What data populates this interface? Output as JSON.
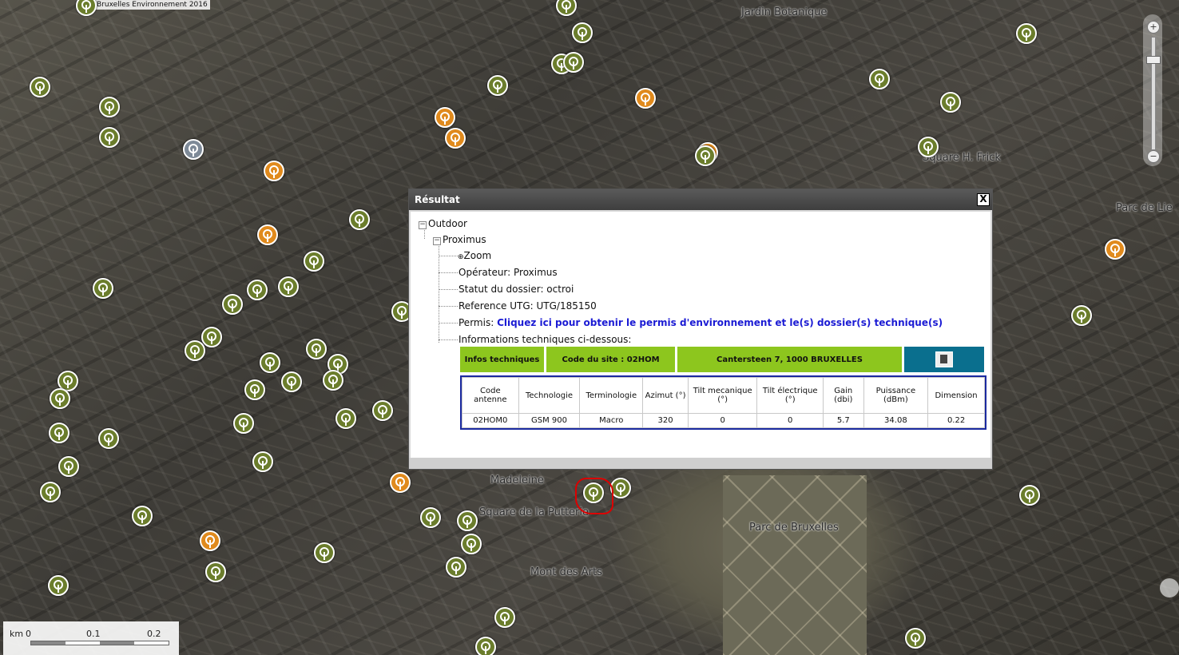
{
  "map": {
    "copyright": "Bruxelles Environnement 2016",
    "labels": [
      "Jardin Botanique",
      "Square H. Frick",
      "Parc de Lie",
      "Madeleine",
      "Square de la Putterie",
      "Parc de Bruxelles",
      "Mont des Arts"
    ],
    "marker_colors": {
      "green": "#6b7d2c",
      "orange": "#e08a1d",
      "grey": "#7e8a98"
    }
  },
  "zoom": {
    "plus": "+",
    "minus": "−"
  },
  "scale": {
    "unit": "km",
    "ticks": [
      "0",
      "0.1",
      "0.2"
    ]
  },
  "popup": {
    "title": "Résultat",
    "close": "X",
    "tree": {
      "root": "Outdoor",
      "operator_node": "Proximus",
      "zoom": "Zoom",
      "operateur": "Opérateur: Proximus",
      "statut": "Statut du dossier: octroi",
      "reference": "Reference UTG: UTG/185150",
      "permis_label": "Permis:",
      "permis_link": "Cliquez ici pour obtenir le permis d'environnement et le(s) dossier(s) technique(s)",
      "infos": "Informations techniques ci-dessous:"
    },
    "bar": {
      "infos": "Infos techniques",
      "code": "Code du site : 02HOM",
      "address": "Cantersteen 7, 1000 BRUXELLES"
    },
    "table": {
      "headers": [
        "Code antenne",
        "Technologie",
        "Terminologie",
        "Azimut (°)",
        "Tilt mecanique (°)",
        "Tilt électrique (°)",
        "Gain (dbi)",
        "Puissance (dBm)",
        "Dimension"
      ],
      "rows": [
        [
          "02HOM0",
          "GSM 900",
          "Macro",
          "320",
          "0",
          "0",
          "5.7",
          "34.08",
          "0.22"
        ]
      ]
    }
  }
}
